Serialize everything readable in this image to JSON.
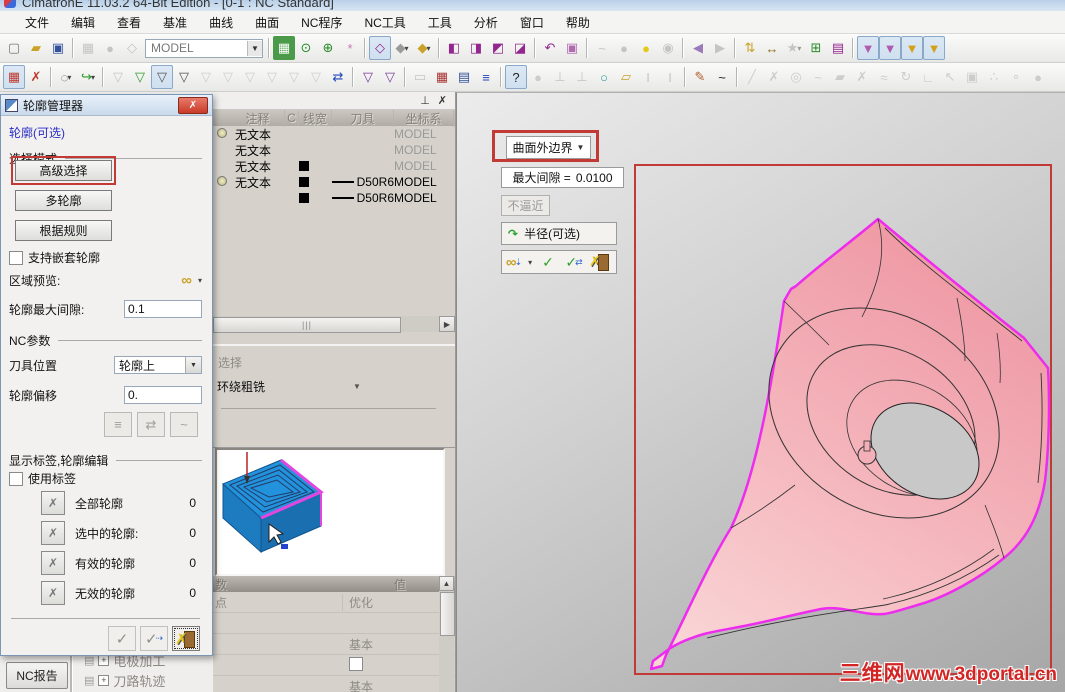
{
  "window": {
    "title": "CimatronE 11.03.2 64-Bit Edition - [0-1 : NC Standard]",
    "menus": [
      "文件",
      "编辑",
      "查看",
      "基准",
      "曲线",
      "曲面",
      "NC程序",
      "NC工具",
      "工具",
      "分析",
      "窗口",
      "帮助"
    ]
  },
  "colors": {
    "accent_red": "#c23a36",
    "selection_magenta": "#ee2bee",
    "model_pink": "#f2a7ad",
    "preview_blue": "#2392dc",
    "preview_magenta": "#e246de",
    "link_blue": "#2a2ac8",
    "check_green": "#2ca02c"
  },
  "toolbars": {
    "model_combo": "MODEL",
    "row1": [
      {
        "n": "new-file-icon",
        "g": "▢",
        "c": "#777"
      },
      {
        "n": "open-file-icon",
        "g": "▰",
        "c": "#c9a227"
      },
      {
        "n": "save-icon",
        "g": "▣",
        "c": "#33539c"
      },
      {
        "t": "s"
      },
      {
        "n": "stock-box-icon",
        "g": "▦",
        "c": "#999",
        "d": 1
      },
      {
        "n": "stock-blob-icon",
        "g": "●",
        "c": "#999",
        "d": 1
      },
      {
        "n": "transform-icon",
        "g": "◇",
        "c": "#999",
        "d": 1
      },
      {
        "t": "c",
        "n": "model-combo"
      },
      {
        "t": "s"
      },
      {
        "n": "render-image-icon",
        "g": "▦",
        "c": "#fff",
        "b": "#4a9a4a"
      },
      {
        "n": "zoom-dynamic-icon",
        "g": "⊙",
        "c": "#2a8a2a"
      },
      {
        "n": "zoom-in-icon",
        "g": "⊕",
        "c": "#2a8a2a"
      },
      {
        "n": "rotate-dynamic-icon",
        "g": "*",
        "c": "#c87ab8"
      },
      {
        "t": "s"
      },
      {
        "n": "wireframe-cube-icon",
        "g": "◇",
        "c": "#93278f",
        "x": 1
      },
      {
        "n": "shaded-cube-icon",
        "g": "◆",
        "c": "#9a9a9a",
        "v": 1
      },
      {
        "n": "pick-face-cube-icon",
        "g": "◆",
        "c": "#c9a227",
        "v": 1
      },
      {
        "t": "s"
      },
      {
        "n": "display-mode-1-icon",
        "g": "◧",
        "c": "#93278f"
      },
      {
        "n": "display-mode-2-icon",
        "g": "◨",
        "c": "#93278f"
      },
      {
        "n": "display-mode-3-icon",
        "g": "◩",
        "c": "#93278f"
      },
      {
        "n": "display-mode-4-icon",
        "g": "◪",
        "c": "#93278f"
      },
      {
        "t": "s"
      },
      {
        "n": "view-restore-icon",
        "g": "↶",
        "c": "#93278f"
      },
      {
        "n": "view-lock-icon",
        "g": "▣",
        "c": "#b06ab0"
      },
      {
        "t": "s"
      },
      {
        "n": "light-path-icon",
        "g": "~",
        "c": "#999",
        "d": 1
      },
      {
        "n": "bulb-off-icon",
        "g": "●",
        "c": "#9a9a9a",
        "d": 1
      },
      {
        "n": "bulb-on-icon",
        "g": "●",
        "c": "#e3c918"
      },
      {
        "n": "bulb-pick-icon",
        "g": "◉",
        "c": "#999",
        "d": 1
      },
      {
        "t": "s"
      },
      {
        "n": "back-arrow-icon",
        "g": "◀",
        "c": "#9a7ab8"
      },
      {
        "n": "forward-arrow-icon",
        "g": "▶",
        "c": "#999",
        "d": 1
      },
      {
        "t": "s"
      },
      {
        "n": "sort-entities-icon",
        "g": "⇅",
        "c": "#c9a227"
      },
      {
        "n": "measure-icon",
        "g": "↔",
        "c": "#8a6d1a"
      },
      {
        "n": "star-icon",
        "g": "★",
        "c": "#999",
        "d": 1,
        "v": 1
      },
      {
        "n": "new-process-icon",
        "g": "⊞",
        "c": "#2a8a2a"
      },
      {
        "n": "entity-list-icon",
        "g": "▤",
        "c": "#93278f"
      },
      {
        "t": "s"
      },
      {
        "n": "tool-axial-icon",
        "g": "▼",
        "c": "#b05ab0",
        "x": 1
      },
      {
        "n": "tool-radial-icon",
        "g": "▼",
        "c": "#b05ab0",
        "x": 1
      },
      {
        "n": "tool-ball-1-icon",
        "g": "▼",
        "c": "#d4a017",
        "x": 1
      },
      {
        "n": "tool-ball-2-icon",
        "g": "▼",
        "c": "#d4a017",
        "x": 1
      }
    ],
    "row2": [
      {
        "n": "grid-select-icon",
        "g": "▦",
        "c": "#c03a30",
        "x": 1
      },
      {
        "n": "unselect-icon",
        "g": "✗",
        "c": "#c03a30"
      },
      {
        "t": "s"
      },
      {
        "n": "marquee-select-icon",
        "g": "◌",
        "c": "#555",
        "v": 1
      },
      {
        "n": "chain-select-icon",
        "g": "↪",
        "c": "#2a9a2a",
        "v": 1
      },
      {
        "t": "s"
      },
      {
        "n": "filter-group-icon",
        "g": "▽",
        "c": "#999",
        "d": 1
      },
      {
        "n": "filter-on-icon",
        "g": "▽",
        "c": "#2a9a2a"
      },
      {
        "n": "filter-pick-icon",
        "g": "▽",
        "c": "#555",
        "x": 1
      },
      {
        "n": "filter-curve-icon",
        "g": "▽",
        "c": "#555"
      },
      {
        "n": "filter-point-icon",
        "g": "▽",
        "c": "#aaa",
        "d": 1
      },
      {
        "n": "filter-surface-icon",
        "g": "▽",
        "c": "#aaa",
        "d": 1
      },
      {
        "n": "filter-solid-icon",
        "g": "▽",
        "c": "#aaa",
        "d": 1
      },
      {
        "n": "filter-direction-icon",
        "g": "▽",
        "c": "#aaa",
        "d": 1
      },
      {
        "n": "filter-text-icon",
        "g": "▽",
        "c": "#aaa",
        "d": 1
      },
      {
        "n": "filter-range-icon",
        "g": "▽",
        "c": "#aaa",
        "d": 1
      },
      {
        "n": "selection-list-icon",
        "g": "⇄",
        "c": "#2244bb"
      },
      {
        "t": "s"
      },
      {
        "n": "filter-node-icon",
        "g": "▽",
        "c": "#7a3a9a"
      },
      {
        "n": "filter-add-icon",
        "g": "▽",
        "c": "#7a3a9a"
      },
      {
        "t": "s"
      },
      {
        "n": "annotation-icon",
        "g": "▭",
        "c": "#999",
        "d": 1
      },
      {
        "n": "table-view-icon",
        "g": "▦",
        "c": "#aa3333"
      },
      {
        "n": "properties-icon",
        "g": "▤",
        "c": "#33539c"
      },
      {
        "n": "sort-list-icon",
        "g": "≡",
        "c": "#2244bb"
      },
      {
        "t": "s"
      },
      {
        "n": "help-icon",
        "g": "?",
        "c": "#222",
        "x": 1
      },
      {
        "n": "snap-icon",
        "g": "●",
        "c": "#aaa",
        "d": 1
      },
      {
        "n": "pin-icon",
        "g": "⊥",
        "c": "#999",
        "d": 1
      },
      {
        "n": "pin-small-icon",
        "g": "⊥",
        "c": "#999",
        "d": 1
      },
      {
        "n": "node-link-icon",
        "g": "○",
        "c": "#2a9a9a"
      },
      {
        "n": "sketch-face-icon",
        "g": "▱",
        "c": "#c9a227"
      },
      {
        "n": "text-cursor-icon",
        "g": "I",
        "c": "#999",
        "d": 1
      },
      {
        "n": "text-list-icon",
        "g": "I",
        "c": "#999",
        "d": 1
      },
      {
        "t": "s"
      },
      {
        "n": "sketcher-icon",
        "g": "✎",
        "c": "#b05a2a"
      },
      {
        "n": "curve-icon",
        "g": "~",
        "c": "#222"
      },
      {
        "t": "s"
      },
      {
        "n": "line-icon",
        "g": "╱",
        "c": "#aaa",
        "d": 1
      },
      {
        "n": "point-line-icon",
        "g": "✗",
        "c": "#aaa",
        "d": 1
      },
      {
        "n": "circle-icon",
        "g": "◎",
        "c": "#aaa",
        "d": 1
      },
      {
        "n": "spline-icon",
        "g": "~",
        "c": "#aaa",
        "d": 1
      },
      {
        "n": "surface-icon",
        "g": "▰",
        "c": "#aaa",
        "d": 1
      },
      {
        "n": "trim-icon",
        "g": "✗",
        "c": "#aaa",
        "d": 1
      },
      {
        "n": "extend-icon",
        "g": "≈",
        "c": "#aaa",
        "d": 1
      },
      {
        "n": "round-icon",
        "g": "↻",
        "c": "#aaa",
        "d": 1
      },
      {
        "n": "corner-icon",
        "g": "∟",
        "c": "#aaa",
        "d": 1
      },
      {
        "n": "pick-point-icon",
        "g": "↖",
        "c": "#aaa",
        "d": 1
      },
      {
        "n": "frame-icon",
        "g": "▣",
        "c": "#aaa",
        "d": 1
      },
      {
        "n": "xyz-icon",
        "g": "∴",
        "c": "#aaa",
        "d": 1
      },
      {
        "n": "point-coord-icon",
        "g": "∘",
        "c": "#aaa",
        "d": 1
      },
      {
        "n": "blob-icon",
        "g": "●",
        "c": "#aaa",
        "d": 1
      }
    ]
  },
  "profile_manager": {
    "title": "轮廓管理器",
    "section_link": "轮廓(可选)",
    "selection_mode_label": "选择模式",
    "buttons": {
      "advanced": "高级选择",
      "multi": "多轮廓",
      "by_rule": "根据规则"
    },
    "nested_checkbox": "支持嵌套轮廓",
    "area_preview_label": "区域预览:",
    "max_gap_label": "轮廓最大间隙:",
    "max_gap_value": "0.1",
    "nc_params_label": "NC参数",
    "tool_pos_label": "刀具位置",
    "tool_pos_value": "轮廓上",
    "offset_label": "轮廓偏移",
    "offset_value": "0.",
    "labels_section": "显示标签,轮廓编辑",
    "use_labels_checkbox": "使用标签",
    "counters": [
      {
        "label": "全部轮廓",
        "value": "0"
      },
      {
        "label": "选中的轮廓:",
        "value": "0"
      },
      {
        "label": "有效的轮廓",
        "value": "0"
      },
      {
        "label": "无效的轮廓",
        "value": "0"
      }
    ]
  },
  "toolpath_table": {
    "headers": [
      "",
      "注释",
      "C",
      "线宽",
      "刀具",
      "坐标系"
    ],
    "rows": [
      {
        "bulb": true,
        "note": "无文本",
        "swatch": false,
        "tool": "",
        "ucs": "MODEL",
        "dim": true
      },
      {
        "bulb": false,
        "note": "无文本",
        "swatch": false,
        "tool": "",
        "ucs": "MODEL",
        "dim": true
      },
      {
        "bulb": false,
        "note": "无文本",
        "swatch": true,
        "tool": "",
        "ucs": "MODEL",
        "dim": true
      },
      {
        "bulb": true,
        "note": "无文本",
        "swatch": true,
        "tool": "D50R6",
        "ucs": "MODEL",
        "dim": false
      },
      {
        "bulb": false,
        "note": "",
        "swatch": true,
        "tool": "D50R6",
        "ucs": "MODEL",
        "dim": false
      }
    ]
  },
  "procedure_panel": {
    "select_label": "选择",
    "procedure_value": "环绕粗铣"
  },
  "params_table": {
    "headers": {
      "param": "数",
      "value": "值"
    },
    "rows": [
      {
        "param": "点",
        "value": "优化",
        "checkbox": false
      },
      {
        "param": "",
        "value": "",
        "checkbox": false
      },
      {
        "param": "",
        "value": "基本",
        "checkbox": false
      },
      {
        "param": "",
        "value": "",
        "checkbox": true
      },
      {
        "param": "",
        "value": "基本",
        "checkbox": false
      }
    ]
  },
  "bottom_left": {
    "nc_report": "NC报告",
    "tree_items": [
      "电极加工",
      "刀路轨迹"
    ]
  },
  "viewport": {
    "boundary_button": "曲面外边界",
    "max_gap_label": "最大间隙 =",
    "max_gap_value": "0.0100",
    "no_approach_button": "不逼近",
    "radius_button": "半径(可选)",
    "watermark_site": "三维网",
    "watermark_url": "www.3dportal.cn"
  }
}
